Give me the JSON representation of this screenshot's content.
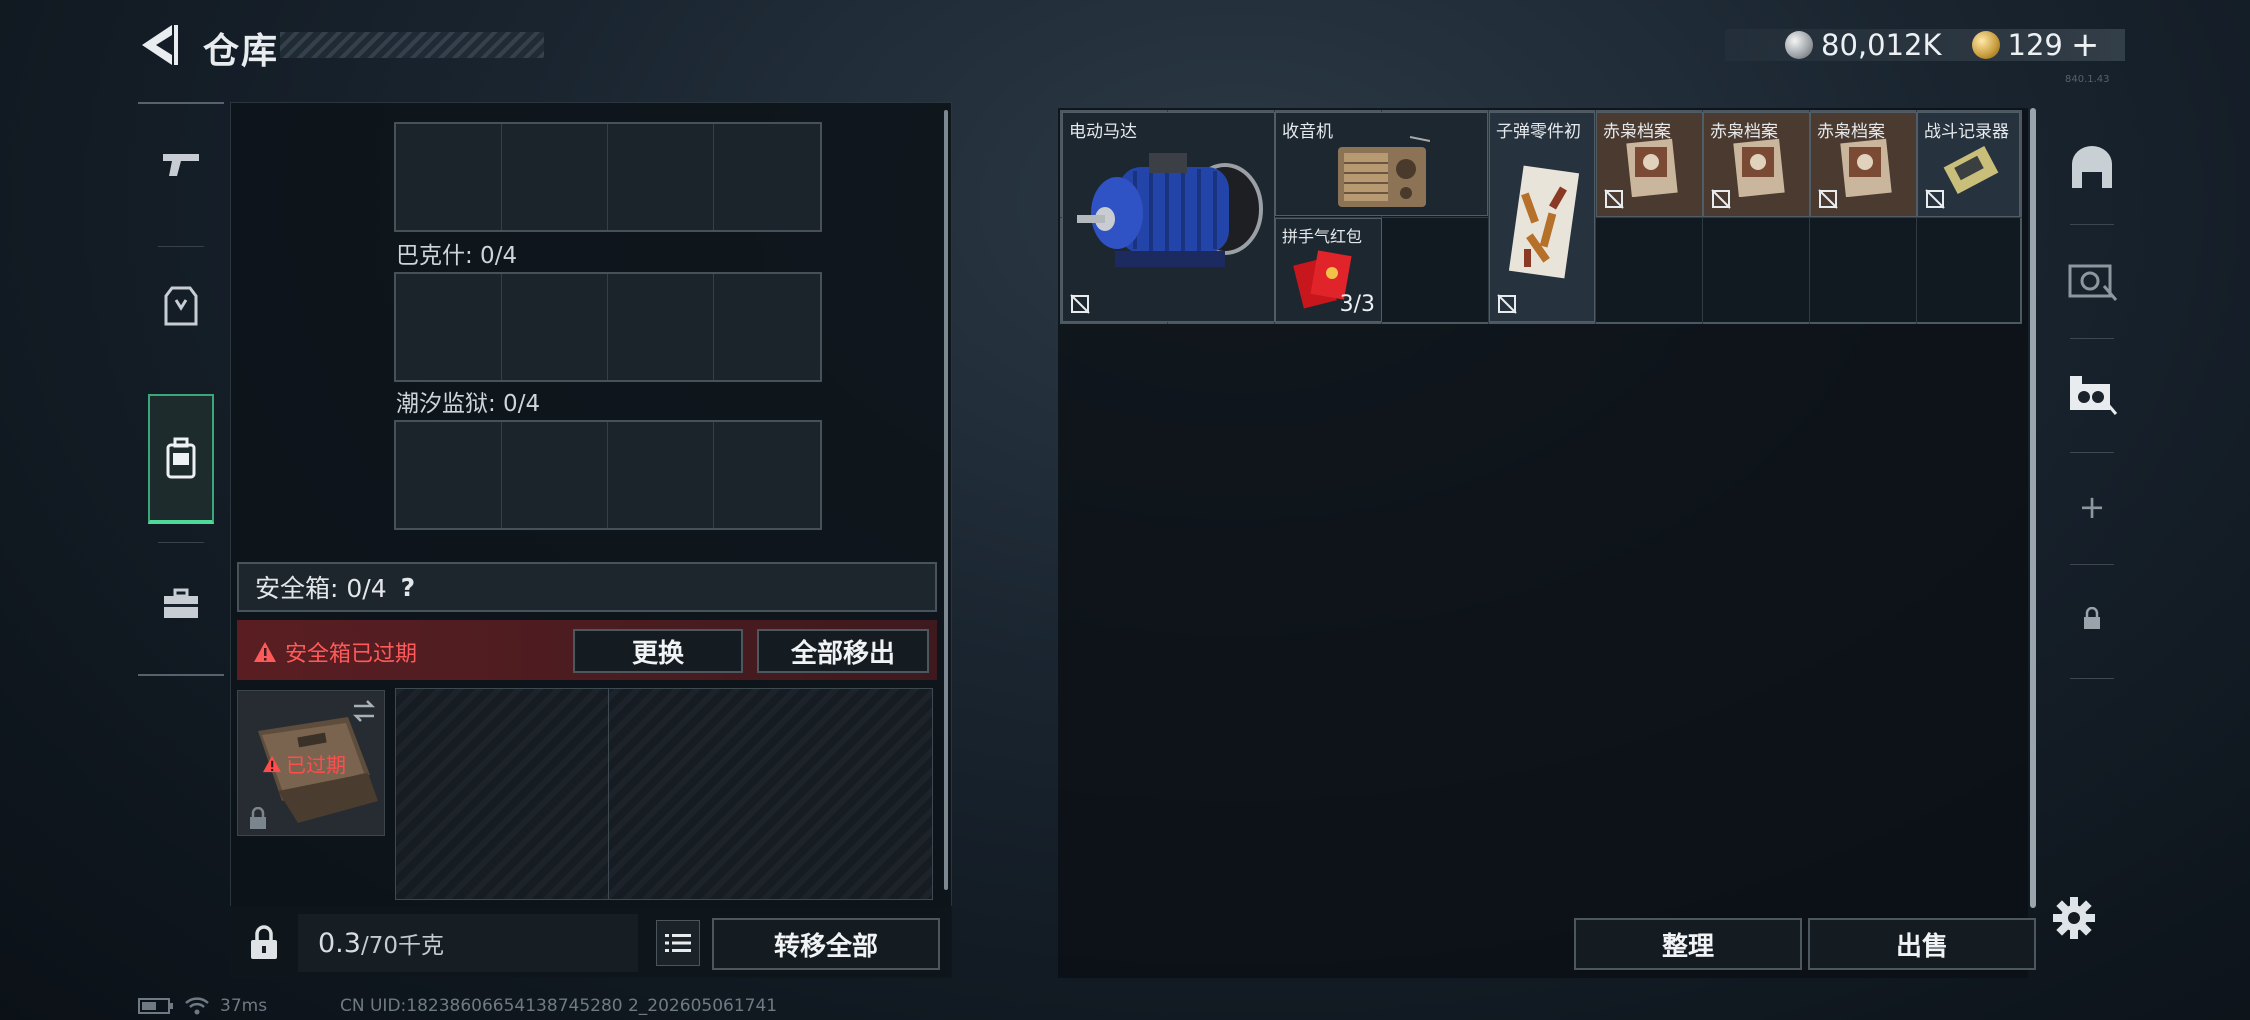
{
  "header": {
    "title": "仓库",
    "currency_silver": "80,012K",
    "currency_gold": "129",
    "gold_plus": "+",
    "version": "840.1.43"
  },
  "left_rail": {
    "tabs": [
      "weapon",
      "armor",
      "backpack",
      "toolbox"
    ],
    "active_tab": "backpack"
  },
  "containers": [
    {
      "label": "",
      "slots": 4
    },
    {
      "label": "巴克什: 0/4",
      "slots": 4
    },
    {
      "label": "潮汐监狱: 0/4",
      "slots": 4
    }
  ],
  "safebox": {
    "label": "安全箱:  0/4",
    "help": "?",
    "expired_warning": "安全箱已过期",
    "replace_button": "更换",
    "move_all_out_button": "全部移出",
    "item_status": "已过期"
  },
  "bottom_left": {
    "weight_current": "0.3",
    "weight_max": "/70千克",
    "transfer_all_button": "转移全部"
  },
  "stash": {
    "items": [
      {
        "name": "电动马达",
        "non_tradable": true
      },
      {
        "name": "收音机",
        "non_tradable": false
      },
      {
        "name": "拼手气红包",
        "count": "3/3",
        "non_tradable": false
      },
      {
        "name": "子弹零件初",
        "non_tradable": true
      },
      {
        "name": "赤枭档案",
        "non_tradable": true
      },
      {
        "name": "赤枭档案",
        "non_tradable": true
      },
      {
        "name": "赤枭档案",
        "non_tradable": true
      },
      {
        "name": "战斗记录器",
        "non_tradable": true
      }
    ],
    "sort_button": "整理",
    "sell_button": "出售"
  },
  "right_rail": {
    "icons": [
      "bunker-icon",
      "loadout-icon",
      "stash-icon",
      "add-icon",
      "lock-icon"
    ],
    "plus": "+"
  },
  "footer": {
    "ping": "37ms",
    "uid": "CN UID:18238606654138745280 2_202605061741"
  },
  "colors": {
    "accent_green": "#4fd89a",
    "warning_red": "#ff5a5a",
    "expired_bg": "#5a1e22"
  }
}
